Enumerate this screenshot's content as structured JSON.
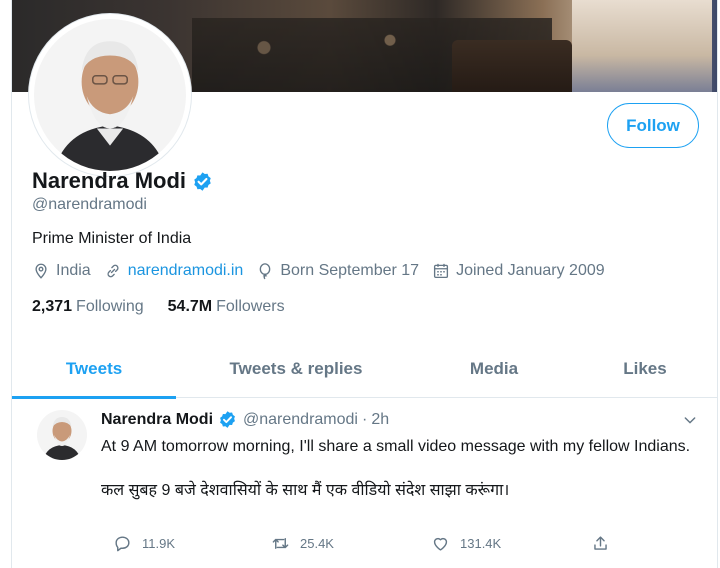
{
  "profile": {
    "name": "Narendra Modi",
    "handle": "@narendramodi",
    "bio": "Prime Minister of India",
    "location": "India",
    "website": "narendramodi.in",
    "born": "Born September 17",
    "joined": "Joined January 2009",
    "following_count": "2,371",
    "following_label": "Following",
    "followers_count": "54.7M",
    "followers_label": "Followers",
    "follow_button": "Follow"
  },
  "tabs": [
    {
      "label": "Tweets",
      "active": true
    },
    {
      "label": "Tweets & replies",
      "active": false
    },
    {
      "label": "Media",
      "active": false
    },
    {
      "label": "Likes",
      "active": false
    }
  ],
  "tweet": {
    "name": "Narendra Modi",
    "handle": "@narendramodi",
    "separator": "·",
    "time": "2h",
    "text_line1": "At 9 AM tomorrow morning, I'll share a small video message with my fellow Indians.",
    "text_line2": "कल सुबह 9 बजे देशवासियों के साथ मैं एक वीडियो संदेश साझा करूंगा।",
    "replies": "11.9K",
    "retweets": "25.4K",
    "likes": "131.4K"
  },
  "icons": {
    "verified": "verified-badge-icon",
    "location": "location-pin-icon",
    "link": "link-icon",
    "birthday": "balloon-icon",
    "calendar": "calendar-icon",
    "reply": "reply-icon",
    "retweet": "retweet-icon",
    "like": "heart-icon",
    "share": "share-icon",
    "caret": "chevron-down-icon"
  },
  "colors": {
    "accent": "#1da1f2",
    "link": "#1b95e0",
    "text": "#14171a",
    "muted": "#657786",
    "border": "#e1e8ed"
  }
}
